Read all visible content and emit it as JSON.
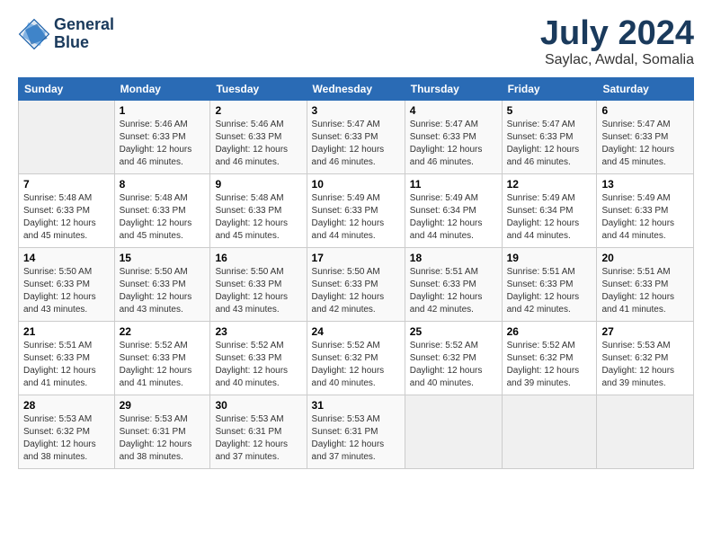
{
  "header": {
    "logo_line1": "General",
    "logo_line2": "Blue",
    "month": "July 2024",
    "location": "Saylac, Awdal, Somalia"
  },
  "weekdays": [
    "Sunday",
    "Monday",
    "Tuesday",
    "Wednesday",
    "Thursday",
    "Friday",
    "Saturday"
  ],
  "weeks": [
    [
      {
        "day": "",
        "info": ""
      },
      {
        "day": "1",
        "info": "Sunrise: 5:46 AM\nSunset: 6:33 PM\nDaylight: 12 hours\nand 46 minutes."
      },
      {
        "day": "2",
        "info": "Sunrise: 5:46 AM\nSunset: 6:33 PM\nDaylight: 12 hours\nand 46 minutes."
      },
      {
        "day": "3",
        "info": "Sunrise: 5:47 AM\nSunset: 6:33 PM\nDaylight: 12 hours\nand 46 minutes."
      },
      {
        "day": "4",
        "info": "Sunrise: 5:47 AM\nSunset: 6:33 PM\nDaylight: 12 hours\nand 46 minutes."
      },
      {
        "day": "5",
        "info": "Sunrise: 5:47 AM\nSunset: 6:33 PM\nDaylight: 12 hours\nand 46 minutes."
      },
      {
        "day": "6",
        "info": "Sunrise: 5:47 AM\nSunset: 6:33 PM\nDaylight: 12 hours\nand 45 minutes."
      }
    ],
    [
      {
        "day": "7",
        "info": "Sunrise: 5:48 AM\nSunset: 6:33 PM\nDaylight: 12 hours\nand 45 minutes."
      },
      {
        "day": "8",
        "info": "Sunrise: 5:48 AM\nSunset: 6:33 PM\nDaylight: 12 hours\nand 45 minutes."
      },
      {
        "day": "9",
        "info": "Sunrise: 5:48 AM\nSunset: 6:33 PM\nDaylight: 12 hours\nand 45 minutes."
      },
      {
        "day": "10",
        "info": "Sunrise: 5:49 AM\nSunset: 6:33 PM\nDaylight: 12 hours\nand 44 minutes."
      },
      {
        "day": "11",
        "info": "Sunrise: 5:49 AM\nSunset: 6:34 PM\nDaylight: 12 hours\nand 44 minutes."
      },
      {
        "day": "12",
        "info": "Sunrise: 5:49 AM\nSunset: 6:34 PM\nDaylight: 12 hours\nand 44 minutes."
      },
      {
        "day": "13",
        "info": "Sunrise: 5:49 AM\nSunset: 6:33 PM\nDaylight: 12 hours\nand 44 minutes."
      }
    ],
    [
      {
        "day": "14",
        "info": "Sunrise: 5:50 AM\nSunset: 6:33 PM\nDaylight: 12 hours\nand 43 minutes."
      },
      {
        "day": "15",
        "info": "Sunrise: 5:50 AM\nSunset: 6:33 PM\nDaylight: 12 hours\nand 43 minutes."
      },
      {
        "day": "16",
        "info": "Sunrise: 5:50 AM\nSunset: 6:33 PM\nDaylight: 12 hours\nand 43 minutes."
      },
      {
        "day": "17",
        "info": "Sunrise: 5:50 AM\nSunset: 6:33 PM\nDaylight: 12 hours\nand 42 minutes."
      },
      {
        "day": "18",
        "info": "Sunrise: 5:51 AM\nSunset: 6:33 PM\nDaylight: 12 hours\nand 42 minutes."
      },
      {
        "day": "19",
        "info": "Sunrise: 5:51 AM\nSunset: 6:33 PM\nDaylight: 12 hours\nand 42 minutes."
      },
      {
        "day": "20",
        "info": "Sunrise: 5:51 AM\nSunset: 6:33 PM\nDaylight: 12 hours\nand 41 minutes."
      }
    ],
    [
      {
        "day": "21",
        "info": "Sunrise: 5:51 AM\nSunset: 6:33 PM\nDaylight: 12 hours\nand 41 minutes."
      },
      {
        "day": "22",
        "info": "Sunrise: 5:52 AM\nSunset: 6:33 PM\nDaylight: 12 hours\nand 41 minutes."
      },
      {
        "day": "23",
        "info": "Sunrise: 5:52 AM\nSunset: 6:33 PM\nDaylight: 12 hours\nand 40 minutes."
      },
      {
        "day": "24",
        "info": "Sunrise: 5:52 AM\nSunset: 6:32 PM\nDaylight: 12 hours\nand 40 minutes."
      },
      {
        "day": "25",
        "info": "Sunrise: 5:52 AM\nSunset: 6:32 PM\nDaylight: 12 hours\nand 40 minutes."
      },
      {
        "day": "26",
        "info": "Sunrise: 5:52 AM\nSunset: 6:32 PM\nDaylight: 12 hours\nand 39 minutes."
      },
      {
        "day": "27",
        "info": "Sunrise: 5:53 AM\nSunset: 6:32 PM\nDaylight: 12 hours\nand 39 minutes."
      }
    ],
    [
      {
        "day": "28",
        "info": "Sunrise: 5:53 AM\nSunset: 6:32 PM\nDaylight: 12 hours\nand 38 minutes."
      },
      {
        "day": "29",
        "info": "Sunrise: 5:53 AM\nSunset: 6:31 PM\nDaylight: 12 hours\nand 38 minutes."
      },
      {
        "day": "30",
        "info": "Sunrise: 5:53 AM\nSunset: 6:31 PM\nDaylight: 12 hours\nand 37 minutes."
      },
      {
        "day": "31",
        "info": "Sunrise: 5:53 AM\nSunset: 6:31 PM\nDaylight: 12 hours\nand 37 minutes."
      },
      {
        "day": "",
        "info": ""
      },
      {
        "day": "",
        "info": ""
      },
      {
        "day": "",
        "info": ""
      }
    ]
  ]
}
